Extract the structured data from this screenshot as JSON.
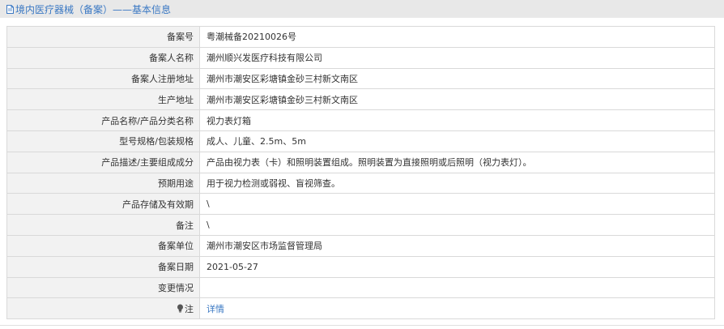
{
  "header": {
    "title": "境内医疗器械（备案）——基本信息",
    "icon": "document-icon"
  },
  "rows": [
    {
      "label": "备案号",
      "value": "粤潮械备20210026号"
    },
    {
      "label": "备案人名称",
      "value": "潮州顺兴发医疗科技有限公司"
    },
    {
      "label": "备案人注册地址",
      "value": "潮州市潮安区彩塘镇金砂三村新文南区"
    },
    {
      "label": "生产地址",
      "value": "潮州市潮安区彩塘镇金砂三村新文南区"
    },
    {
      "label": "产品名称/产品分类名称",
      "value": "视力表灯箱"
    },
    {
      "label": "型号规格/包装规格",
      "value": "成人、儿童、2.5m、5m"
    },
    {
      "label": "产品描述/主要组成成分",
      "value": "产品由视力表（卡）和照明装置组成。照明装置为直接照明或后照明（视力表灯）。"
    },
    {
      "label": "预期用途",
      "value": "用于视力检测或弱视、盲视筛查。"
    },
    {
      "label": "产品存储及有效期",
      "value": "\\"
    },
    {
      "label": "备注",
      "value": "\\"
    },
    {
      "label": "备案单位",
      "value": "潮州市潮安区市场监督管理局"
    },
    {
      "label": "备案日期",
      "value": "2021-05-27"
    },
    {
      "label": "变更情况",
      "value": ""
    }
  ],
  "note": {
    "label": "注",
    "icon": "lightbulb-icon",
    "link_text": "详情"
  },
  "colors": {
    "accent": "#3a78c3",
    "label_bg": "#f2f2f2",
    "border": "#d9d9d9",
    "title_bg": "#e8e8e8"
  }
}
